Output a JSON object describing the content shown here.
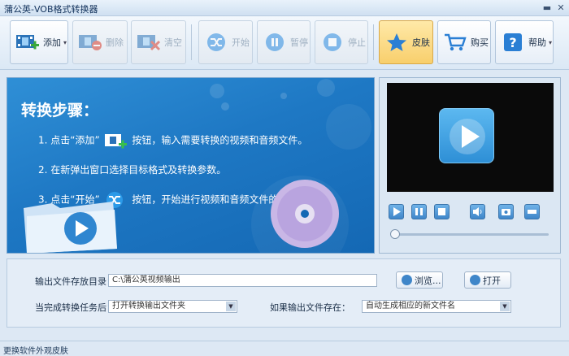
{
  "window": {
    "title": "蒲公英-VOB格式转换器",
    "minimize_glyph": "▬",
    "close_glyph": "✕"
  },
  "toolbar": {
    "add": "添加",
    "delete": "删除",
    "clear": "清空",
    "start": "开始",
    "pause": "暂停",
    "stop": "停止",
    "skin": "皮肤",
    "buy": "购买",
    "help": "帮助",
    "dropdown_glyph": "▾"
  },
  "steps": {
    "title": "转换步骤：",
    "step1_prefix": "1. 点击“添加”",
    "step1_suffix": "按钮，输入需要转换的视频和音频文件。",
    "step2": "2. 在新弹出窗口选择目标格式及转换参数。",
    "step3_prefix": "3. 点击“开始”",
    "step3_suffix": "按钮，开始进行视频和音频文件的转换。"
  },
  "player": {
    "controls": [
      "play",
      "pause",
      "stop",
      "volume",
      "snapshot",
      "fullscreen"
    ],
    "position": 0
  },
  "settings": {
    "output_dir_label": "输出文件存放目录：",
    "output_dir_value": "C:\\蒲公英视频输出",
    "browse": "浏览...",
    "open": "打开",
    "after_done_label": "当完成转换任务后：",
    "after_done_value": "打开转换输出文件夹",
    "if_exists_label": "如果输出文件存在：",
    "if_exists_value": "自动生成相应的新文件名",
    "combo_glyph": "▼"
  },
  "status": {
    "skin_link": "更换软件外观皮肤"
  },
  "colors": {
    "accent": "#1e78c4",
    "skin_button": "#f8cf6c"
  }
}
